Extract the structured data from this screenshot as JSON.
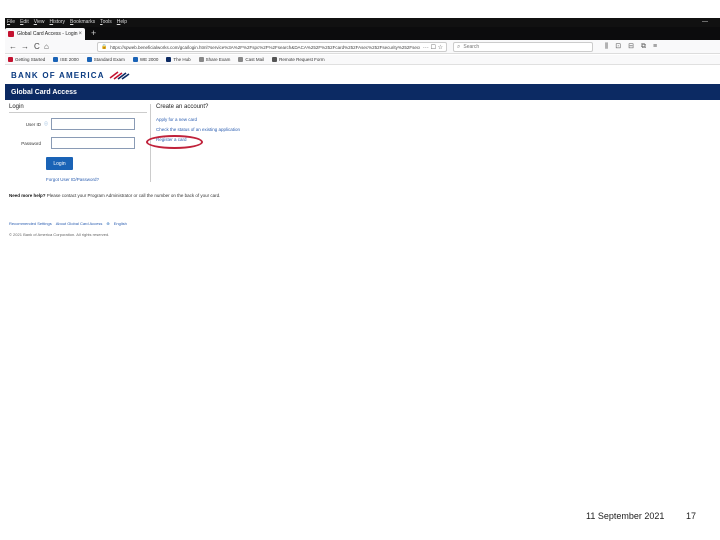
{
  "menu": [
    "File",
    "Edit",
    "View",
    "History",
    "Bookmarks",
    "Tools",
    "Help"
  ],
  "window_controls": "—",
  "tab": {
    "title": "Global Card Access - Login",
    "close": "×",
    "new": "+"
  },
  "nav": {
    "back": "←",
    "forward": "→",
    "reload": "C",
    "home": "⌂",
    "url": "https://spweb.beneficialworks.com/gca/login.html?service%3A%2F%2Fspc%2F%2Fsearch&DACA%252F%252Fcard%252FAsec%252Fsecurity%252Fsecuritylogin&pagelang=en",
    "page_actions": "··· ☐ ☆",
    "search_placeholder": "Search",
    "toolbar_icons": [
      "⫼",
      "⊡",
      "⊟",
      "⧉",
      "≡"
    ]
  },
  "bookmarks": [
    "Getting Started",
    "ISE 2000",
    "Standard Exam",
    "WE 2000",
    "The Hub",
    "Share Exam",
    "Cast Mail",
    "Remote Request Form"
  ],
  "brand": {
    "logo": "BANK OF AMERICA",
    "bar_title": "Global Card Access"
  },
  "login": {
    "heading": "Login",
    "user_label": "User ID",
    "password_label": "Password",
    "info_icon": "ⓘ",
    "button": "Login",
    "forgot": "Forgot User ID/Password?"
  },
  "create": {
    "heading": "Create an account?",
    "links": [
      "Apply for a new card",
      "Check the status of an existing application",
      "Register a card"
    ]
  },
  "help": {
    "bold": "Need more help?",
    "text": " Please contact your Program Administrator or call the number on the back of your card."
  },
  "footer": {
    "links": [
      "Recommended Settings",
      "About Global Card Access",
      "English"
    ],
    "globe": "⊕",
    "copyright": "© 2021 Bank of America Corporation. All rights reserved."
  },
  "slide": {
    "date": "11 September 2021",
    "page": "17"
  },
  "colors": {
    "brand_navy": "#0c2a63",
    "brand_red": "#c41230",
    "button_blue": "#1a63b6",
    "highlight_ring": "#c0223b"
  }
}
